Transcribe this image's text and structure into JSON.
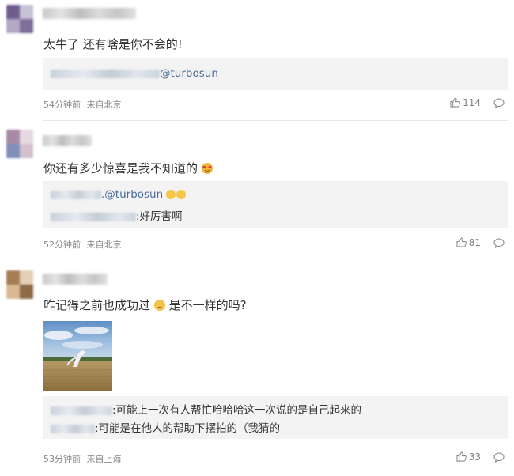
{
  "comments": [
    {
      "text": "太牛了 还有啥是你不会的!",
      "reply": {
        "mention": "@turbosun"
      },
      "time": "54分钟前",
      "source": "来自北京",
      "likes": "114"
    },
    {
      "text": "你还有多少惊喜是我不知道的",
      "reply": {
        "mention": ".@turbosun",
        "line2": ":好厉害啊"
      },
      "time": "52分钟前",
      "source": "来自北京",
      "likes": "81"
    },
    {
      "text_before": "咋记得之前也成功过",
      "text_after": " 是不一样的吗?",
      "reply": {
        "line1": ":可能上一次有人帮忙哈哈哈这一次说的是自己起来的",
        "line2": ":可能是在他人的帮助下摆拍的（我猜的"
      },
      "time": "53分钟前",
      "source": "来自上海",
      "likes": "33"
    }
  ],
  "icons": {
    "like": "thumbs-up-icon",
    "reply": "speech-bubble-icon",
    "emoji": "emoji-icon"
  },
  "colors": {
    "mention": "#4a6b9a",
    "meta": "#888888",
    "reply_bg": "#f3f3f3",
    "divider": "#e6e6e6"
  }
}
